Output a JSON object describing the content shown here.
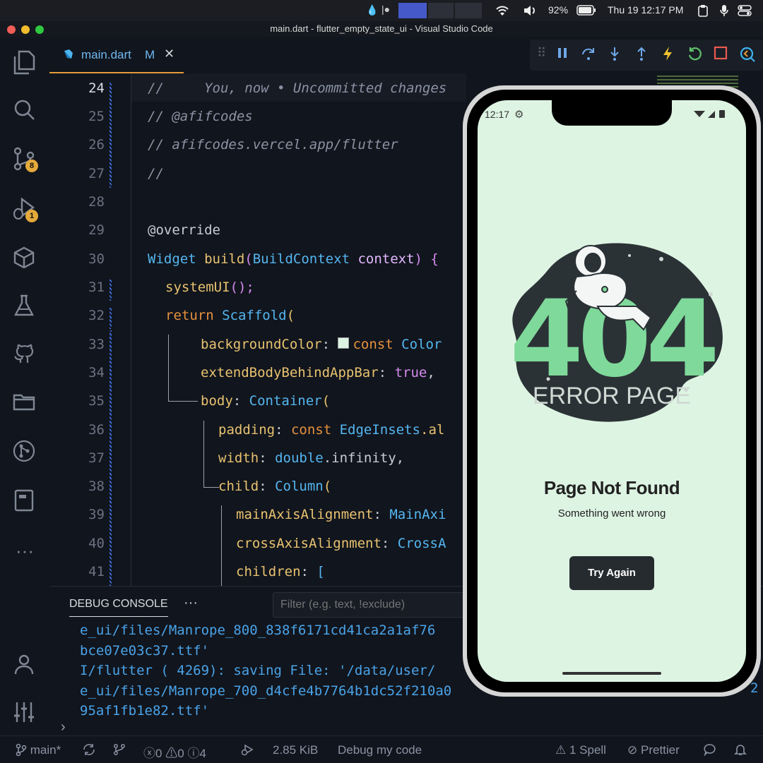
{
  "menubar": {
    "battery": "92%",
    "clock": "Thu 19  12:17 PM"
  },
  "window": {
    "title": "main.dart - flutter_empty_state_ui - Visual Studio Code"
  },
  "activity": {
    "scm_badge": "8",
    "debug_badge": "1"
  },
  "tab": {
    "filename": "main.dart",
    "status": "M"
  },
  "editor": {
    "lines": [
      {
        "num": "24",
        "text": "//     You, now • Uncommitted changes"
      },
      {
        "num": "25",
        "text": "// @afifcodes"
      },
      {
        "num": "26",
        "text": "// afifcodes.vercel.app/flutter"
      },
      {
        "num": "27",
        "text": "//"
      },
      {
        "num": "28",
        "text": ""
      },
      {
        "num": "29",
        "text": "@override"
      },
      {
        "num": "30",
        "t1": "Widget ",
        "t2": "build",
        "t3": "(",
        "t4": "BuildContext",
        "t5": " context",
        "t6": ") {"
      },
      {
        "num": "31",
        "t1": "systemUI",
        "t2": "();"
      },
      {
        "num": "32",
        "t1": "return ",
        "t2": "Scaffold",
        "t3": "("
      },
      {
        "num": "33",
        "t1": "backgroundColor",
        "t2": ": ",
        "t3": "const ",
        "t4": "Color"
      },
      {
        "num": "34",
        "t1": "extendBodyBehindAppBar",
        "t2": ": ",
        "t3": "true",
        "t4": ","
      },
      {
        "num": "35",
        "t1": "body",
        "t2": ": ",
        "t3": "Container",
        "t4": "("
      },
      {
        "num": "36",
        "t1": "padding",
        "t2": ": ",
        "t3": "const ",
        "t4": "EdgeInsets",
        "t5": ".al"
      },
      {
        "num": "37",
        "t1": "width",
        "t2": ": ",
        "t3": "double",
        "t4": ".infinity,"
      },
      {
        "num": "38",
        "t1": "child",
        "t2": ": ",
        "t3": "Column",
        "t4": "("
      },
      {
        "num": "39",
        "t1": "mainAxisAlignment",
        "t2": ": ",
        "t3": "MainAxi"
      },
      {
        "num": "40",
        "t1": "crossAxisAlignment",
        "t2": ": ",
        "t3": "CrossA"
      },
      {
        "num": "41",
        "t1": "children",
        "t2": ": ",
        "t3": "["
      }
    ]
  },
  "panel": {
    "tab_label": "DEBUG CONSOLE",
    "more": "···",
    "filter_placeholder": "Filter (e.g. text, !exclude)",
    "output": [
      "e_ui/files/Manrope_800_838f6171cd41ca2a1af76",
      "bce07e03c37.ttf'",
      "I/flutter ( 4269): saving File: '/data/user/",
      "e_ui/files/Manrope_700_d4cfe4b7764b1dc52f210a0",
      "95af1fb1e82.ttf'"
    ],
    "output_tail_2": "2"
  },
  "statusbar": {
    "branch": "main*",
    "errors": "0",
    "warnings": "0",
    "info": "4",
    "size": "2.85 KiB",
    "launch": "Debug my code",
    "spell": "1 Spell",
    "prettier": "Prettier"
  },
  "phone": {
    "time": "12:17",
    "illustration_number": "404",
    "illustration_caption": "ERROR PAGE",
    "title": "Page Not Found",
    "subtitle": "Something went wrong",
    "button": "Try Again"
  },
  "colors": {
    "accent_tab": "#e59a3a",
    "phone_bg": "#def4e3",
    "blob": "#2b3236",
    "green": "#7fd99a",
    "button": "#262b2f"
  }
}
